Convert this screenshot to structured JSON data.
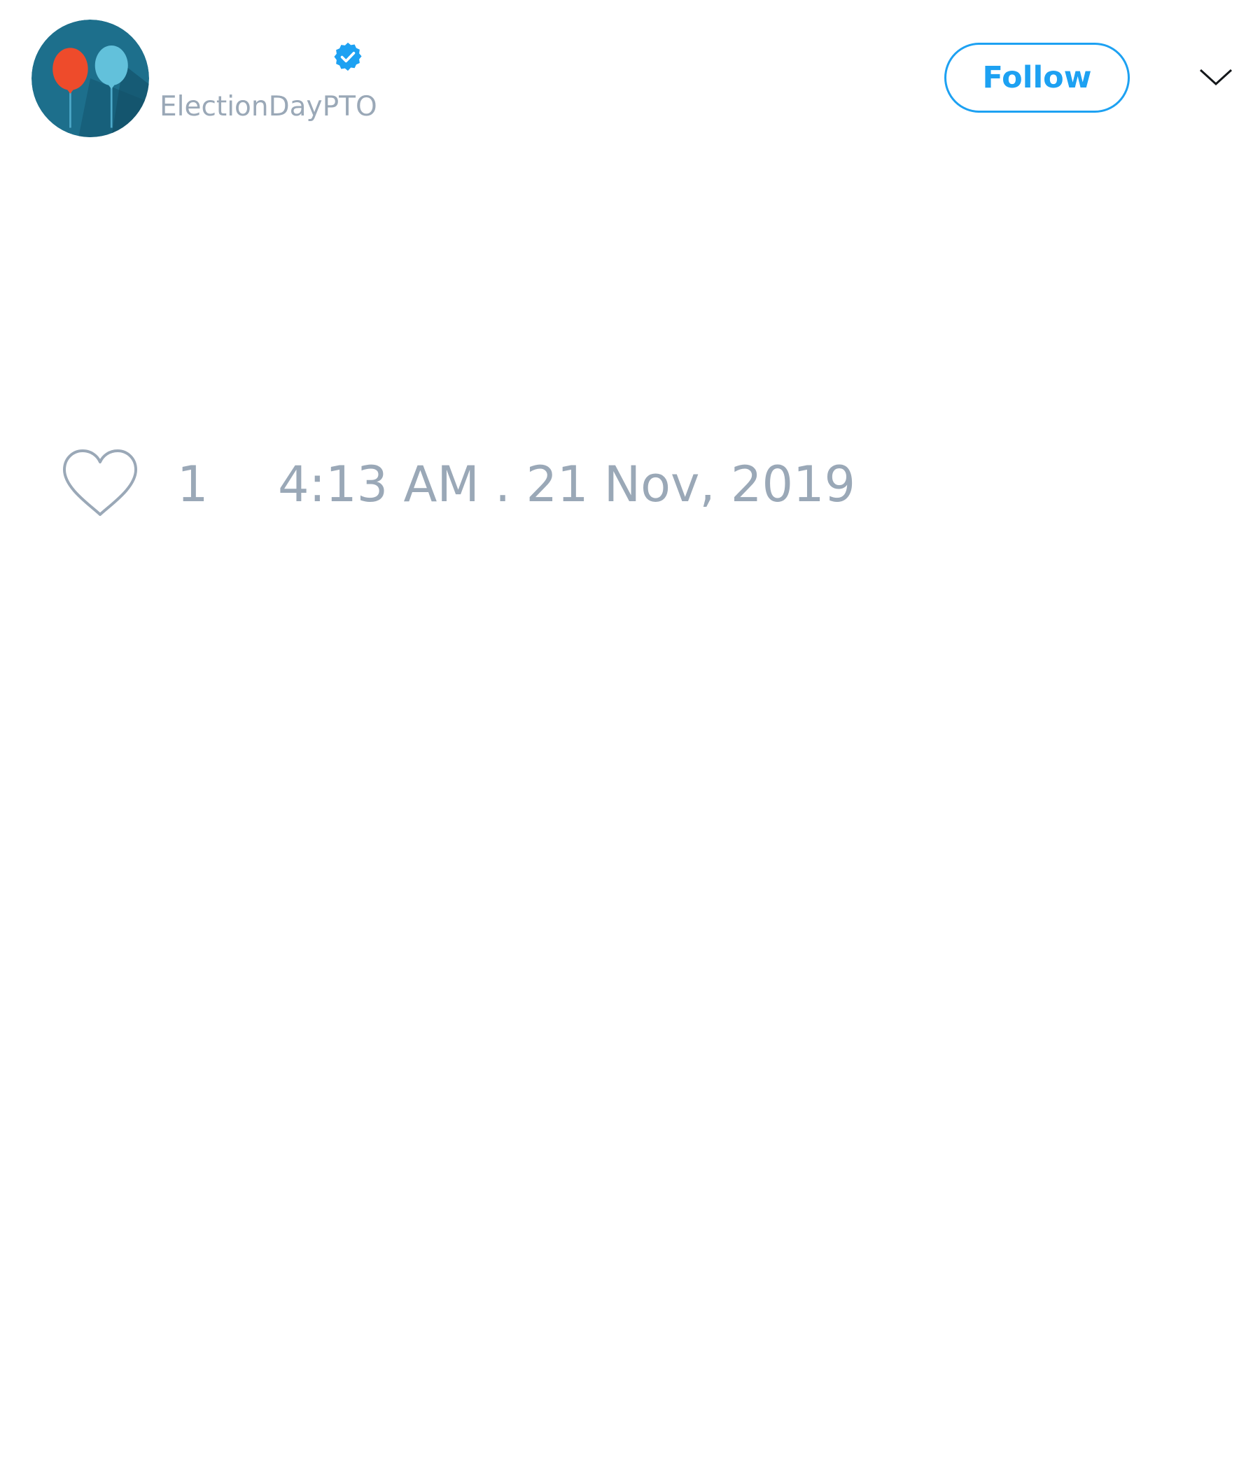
{
  "tweet": {
    "author": {
      "handle": "ElectionDayPTO",
      "verified": true,
      "avatar_icon": "balloons-avatar-icon"
    },
    "follow_button": {
      "label": "Follow"
    },
    "menu_icon": "chevron-down-icon",
    "footer": {
      "like_icon": "heart-icon",
      "like_count": "1",
      "timestamp": "4:13 AM . 21 Nov, 2019"
    }
  },
  "colors": {
    "accent": "#1da1f2",
    "muted_text": "#9aa8b7",
    "avatar_bg": "#1d6f8c",
    "balloon_red": "#ee4b2b",
    "balloon_blue": "#62c1db"
  }
}
